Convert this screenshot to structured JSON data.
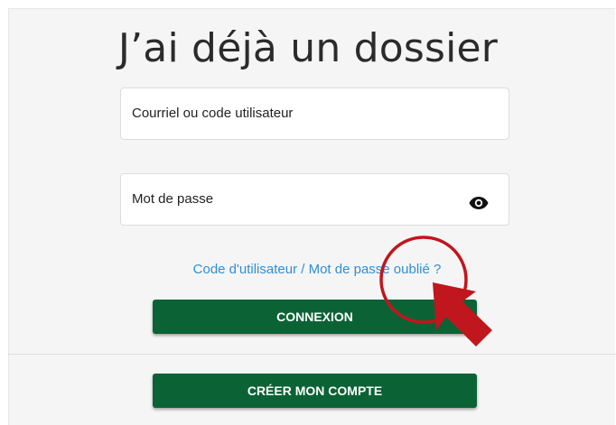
{
  "login": {
    "title": "J’ai déjà un dossier",
    "username_placeholder": "Courriel ou code utilisateur",
    "password_placeholder": "Mot de passe",
    "forgot_link": "Code d'utilisateur / Mot de passe oublié ?",
    "login_button": "CONNEXION",
    "create_account_button": "CRÉER MON COMPTE"
  },
  "icons": {
    "password_toggle": "eye-icon",
    "pointer": "cursor-arrow-icon",
    "highlight": "circle-highlight"
  },
  "colors": {
    "primary_button": "#0b6335",
    "link": "#2e8fd6",
    "annotation": "#c0161d",
    "panel_bg": "#f5f5f5"
  }
}
